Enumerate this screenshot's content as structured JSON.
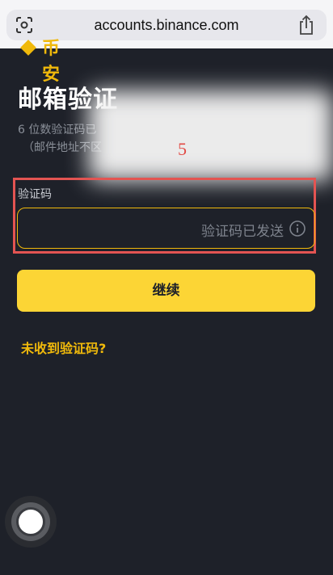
{
  "browser": {
    "url": "accounts.binance.com"
  },
  "logo": {
    "text": "币安"
  },
  "page": {
    "title": "邮箱验证",
    "subtitle_line1": "6 位数验证码已",
    "subtitle_line2": "（邮件地址不区"
  },
  "annotation": {
    "number": "5"
  },
  "form": {
    "code_label": "验证码",
    "code_placeholder": "验证码已发送",
    "continue_label": "继续",
    "resend_link": "未收到验证码?"
  },
  "colors": {
    "background": "#1e2129",
    "accent": "#fcd535",
    "link": "#f0b90b",
    "annotation": "#e35452"
  },
  "icons": [
    "tab-scan-icon",
    "share-icon",
    "info-icon",
    "assistive-touch-icon"
  ]
}
